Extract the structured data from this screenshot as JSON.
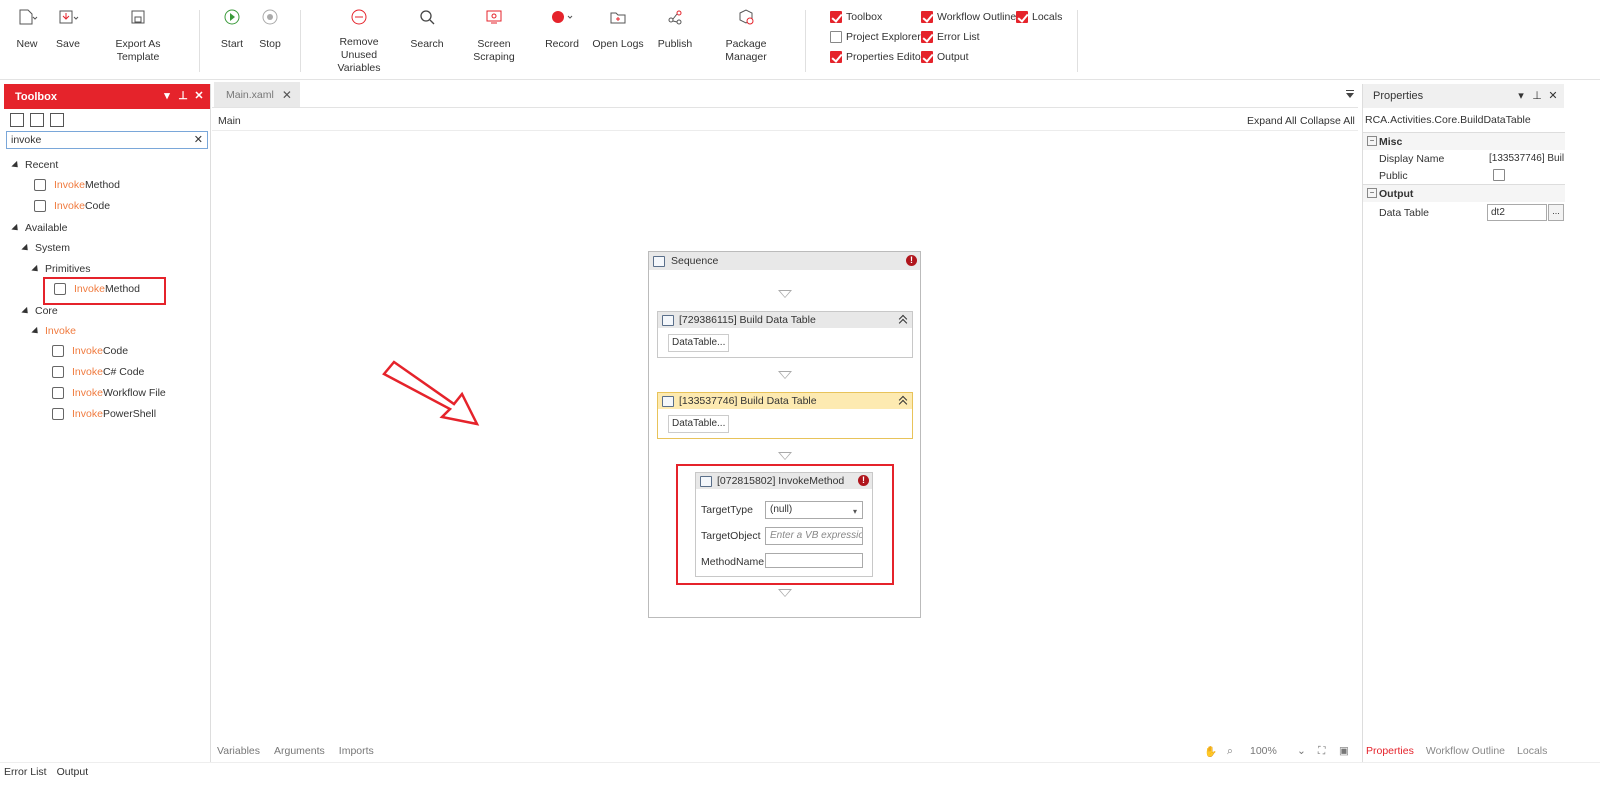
{
  "ribbon": {
    "new": "New",
    "save": "Save",
    "export_template": "Export As Template",
    "start": "Start",
    "stop": "Stop",
    "remove_unused_1": "Remove Unused",
    "remove_unused_2": "Variables",
    "search": "Search",
    "screen_scraping": "Screen Scraping",
    "record": "Record",
    "open_logs": "Open Logs",
    "publish": "Publish",
    "package_manager": "Package Manager"
  },
  "panels": {
    "toolbox": {
      "label": "Toolbox",
      "checked": true
    },
    "project_explorer": {
      "label": "Project Explorer",
      "checked": false
    },
    "properties_editor": {
      "label": "Properties Editor",
      "checked": true
    },
    "workflow_outline": {
      "label": "Workflow Outline",
      "checked": true
    },
    "error_list": {
      "label": "Error List",
      "checked": true
    },
    "output": {
      "label": "Output",
      "checked": true
    },
    "locals": {
      "label": "Locals",
      "checked": true
    }
  },
  "toolbox": {
    "title": "Toolbox",
    "search_value": "invoke",
    "recent": "Recent",
    "available": "Available",
    "system": "System",
    "primitives": "Primitives",
    "core": "Core",
    "match": "Invoke",
    "items": {
      "recent_1": "Method",
      "recent_2": " Code",
      "primitive_1": "Method",
      "core_1": " Code",
      "core_2": " C# Code",
      "core_3": " Workflow File",
      "core_4": " PowerShell"
    }
  },
  "document": {
    "tab": "Main.xaml",
    "breadcrumb": "Main",
    "expand_all": "Expand All",
    "collapse_all": "Collapse All"
  },
  "workflow": {
    "sequence": "Sequence",
    "activity1": {
      "title": "[729386115] Build Data Table",
      "button": "DataTable..."
    },
    "activity2": {
      "title": "[133537746] Build Data Table",
      "button": "DataTable..."
    },
    "invoke": {
      "title": "[072815802] InvokeMethod",
      "target_type_label": "TargetType",
      "target_type_value": "(null)",
      "target_object_label": "TargetObject",
      "target_object_placeholder": "Enter a VB expression",
      "method_name_label": "MethodName",
      "method_name_value": ""
    }
  },
  "canvas_footer": {
    "variables": "Variables",
    "arguments": "Arguments",
    "imports": "Imports",
    "zoom": "100%"
  },
  "properties": {
    "title": "Properties",
    "type": "RCA.Activities.Core.BuildDataTable",
    "misc": "Misc",
    "display_name_label": "Display Name",
    "display_name_value": "[133537746] Buil",
    "public_label": "Public",
    "output": "Output",
    "data_table_label": "Data Table",
    "data_table_value": "dt2",
    "ellipsis": "...",
    "tabs": [
      "Properties",
      "Workflow Outline",
      "Locals"
    ]
  },
  "status": {
    "error_list": "Error List",
    "output": "Output"
  },
  "colors": {
    "accent": "#e5232b",
    "highlight": "#f07b3f"
  }
}
